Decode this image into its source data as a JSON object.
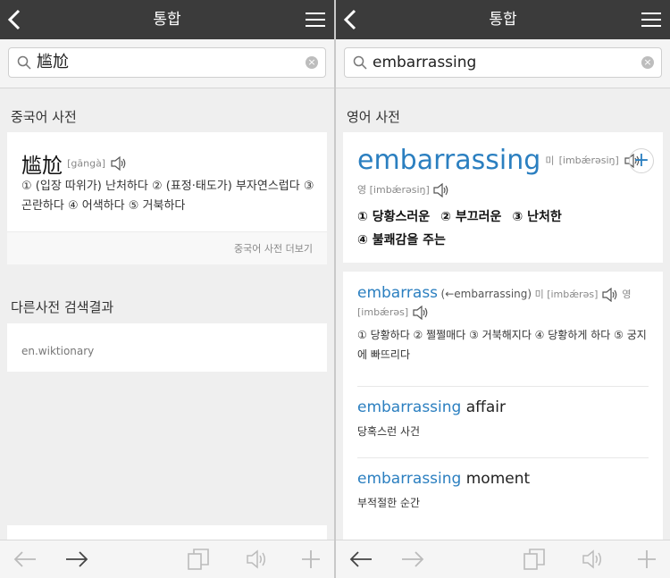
{
  "left": {
    "title": "통합",
    "query": "尴尬",
    "section_chinese": "중국어 사전",
    "zh_entry": {
      "word": "尴尬",
      "pron": "[gāngà]",
      "definition": "① (입장 따위가) 난처하다 ② (표정·태도가) 부자연스럽다 ③ 곤란하다 ④ 어색하다 ⑤ 거북하다",
      "more": "중국어 사전 더보기"
    },
    "section_other": "다른사전 검색결과",
    "other_item": "en.wiktionary"
  },
  "right": {
    "title": "통합",
    "query": "embarrassing",
    "section_english": "영어 사전",
    "main_entry": {
      "word": "embarrassing",
      "us_label": "미",
      "us_pron": "[imbǽrəsiŋ]",
      "uk_label": "영",
      "uk_pron": "[imbǽrəsiŋ]",
      "plus": "+",
      "meanings": [
        "① 당황스러운",
        "② 부끄러운",
        "③ 난처한",
        "④ 불쾌감을 주는"
      ]
    },
    "entries": [
      {
        "word": "embarrass",
        "note": "(←embarrassing)",
        "us_label": "미",
        "us_pron": "[imbǽrəs]",
        "uk_label": "영",
        "uk_pron": "[imbǽrəs]",
        "definition": "① 당황하다 ② 쩔쩔매다 ③ 거북해지다 ④ 당황하게 하다 ⑤ 궁지에 빠뜨리다"
      },
      {
        "word": "embarrassing",
        "rest": " affair",
        "meaning": "당혹스런 사건"
      },
      {
        "word": "embarrassing",
        "rest": " moment",
        "meaning": "부적절한 순간"
      }
    ]
  },
  "colors": {
    "topbar": "#3b3b3b",
    "link_blue": "#2b7fc0",
    "background": "#efefef"
  },
  "icons": {
    "back": "chevron-left-icon",
    "menu": "hamburger-menu-icon",
    "search": "magnifier-icon",
    "clear": "clear-x-icon",
    "speaker": "speaker-icon",
    "nav_back": "arrow-left-icon",
    "nav_forward": "arrow-right-icon",
    "copy": "copy-icon",
    "sound": "speaker-icon",
    "add": "plus-icon"
  }
}
